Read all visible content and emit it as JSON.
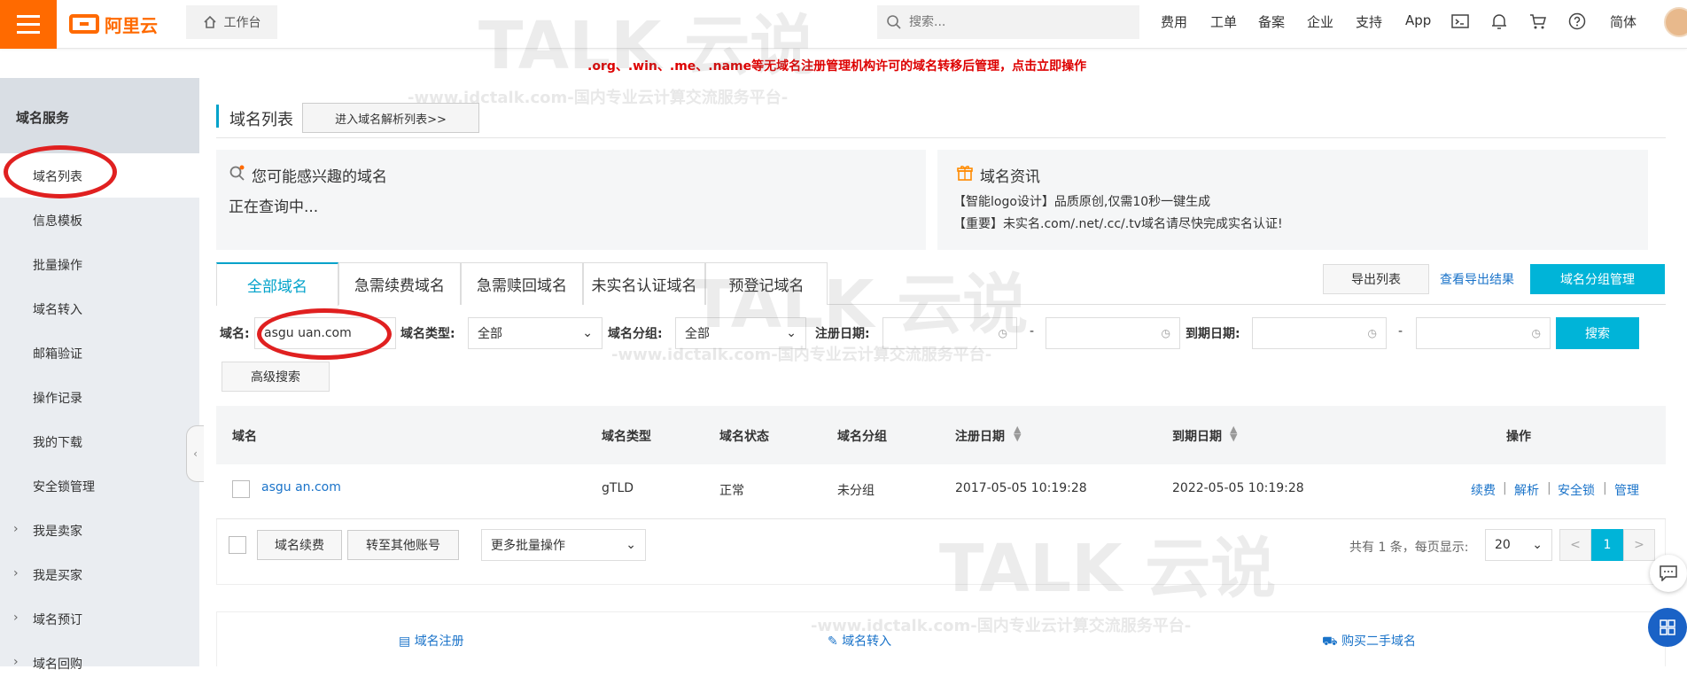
{
  "topbar": {
    "logo_text": "阿里云",
    "workbench_label": "工作台",
    "search_placeholder": "搜索...",
    "nav_items": [
      "费用",
      "工单",
      "备案",
      "企业",
      "支持",
      "App"
    ],
    "lang": "简体",
    "icons": [
      "terminal-icon",
      "bell-icon",
      "cart-icon",
      "help-icon"
    ]
  },
  "notice": ".org、.win、.me、.name等无域名注册管理机构许可的域名转移后管理，点击立即操作",
  "watermark": {
    "brand": "TALK",
    "cn": "云说",
    "url_line": "-www.idctalk.com-国内专业云计算交流服务平台-"
  },
  "sidebar": {
    "header": "域名服务",
    "items": [
      {
        "label": "域名列表",
        "active": true
      },
      {
        "label": "信息模板"
      },
      {
        "label": "批量操作"
      },
      {
        "label": "域名转入"
      },
      {
        "label": "邮箱验证"
      },
      {
        "label": "操作记录"
      },
      {
        "label": "我的下载"
      },
      {
        "label": "安全锁管理"
      },
      {
        "label": "我是卖家",
        "expandable": true
      },
      {
        "label": "我是买家",
        "expandable": true
      },
      {
        "label": "域名预订",
        "expandable": true
      },
      {
        "label": "域名回购",
        "expandable": true
      }
    ]
  },
  "page": {
    "title": "域名列表",
    "dns_button": "进入域名解析列表>>"
  },
  "interest": {
    "title": "您可能感兴趣的域名",
    "status": "正在查询中..."
  },
  "news": {
    "title": "域名资讯",
    "lines": [
      "【智能logo设计】品质原创,仅需10秒一键生成",
      "【重要】未实名.com/.net/.cc/.tv域名请尽快完成实名认证!"
    ]
  },
  "tabs": [
    "全部域名",
    "急需续费域名",
    "急需赎回域名",
    "未实名认证域名",
    "预登记域名"
  ],
  "actions": {
    "export": "导出列表",
    "view_export": "查看导出结果",
    "group_manage": "域名分组管理"
  },
  "filters": {
    "domain_label": "域名:",
    "domain_value": "asgu  uan.com",
    "type_label": "域名类型:",
    "type_value": "全部",
    "group_label": "域名分组:",
    "group_value": "全部",
    "reg_label": "注册日期:",
    "exp_label": "到期日期:",
    "dash": "-",
    "search_btn": "搜索",
    "advanced": "高级搜索"
  },
  "table": {
    "headers": [
      "域名",
      "域名类型",
      "域名状态",
      "域名分组",
      "注册日期",
      "到期日期",
      "操作"
    ],
    "rows": [
      {
        "domain": "asgu    an.com",
        "type": "gTLD",
        "status": "正常",
        "group": "未分组",
        "reg": "2017-05-05 10:19:28",
        "exp": "2022-05-05 10:19:28"
      }
    ],
    "ops": [
      "续费",
      "解析",
      "安全锁",
      "管理"
    ],
    "sep": "|"
  },
  "footer_bar": {
    "renew": "域名续费",
    "transfer": "转至其他账号",
    "more": "更多批量操作",
    "total": "共有 1 条，每页显示:",
    "page_size": "20",
    "page": "1",
    "prev": "<",
    "next": ">"
  },
  "bottom_links": [
    "域名注册",
    "域名转入",
    "购买二手域名"
  ],
  "colors": {
    "accent": "#ff6a00",
    "primary": "#00b4d8",
    "link": "#1a73c9",
    "notice": "#dd0000",
    "annotation": "#e02020"
  }
}
